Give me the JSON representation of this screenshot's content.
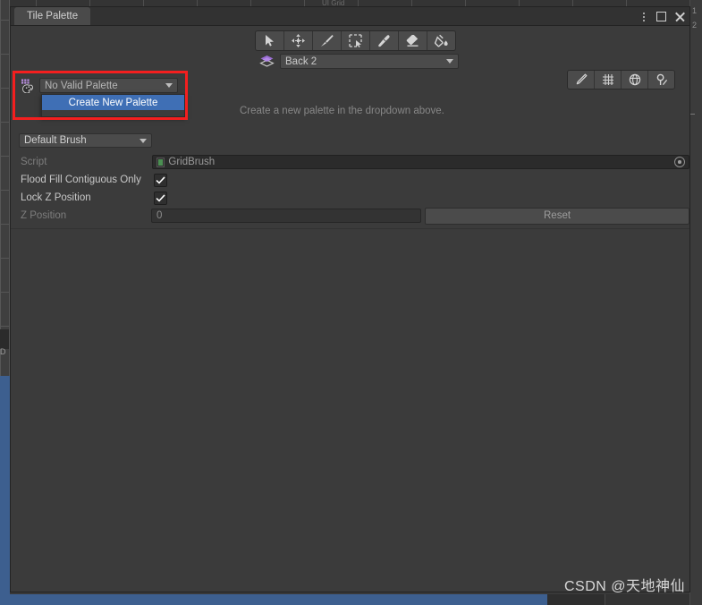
{
  "window": {
    "tab_label": "Tile Palette",
    "controls": {
      "menu": "kebab-menu",
      "maximize": "maximize",
      "close": "close"
    }
  },
  "toolbar": {
    "tools": [
      {
        "name": "select-tool",
        "tooltip": "Select"
      },
      {
        "name": "move-tool",
        "tooltip": "Move"
      },
      {
        "name": "paint-tool",
        "tooltip": "Paint"
      },
      {
        "name": "box-fill-tool",
        "tooltip": "Box Fill"
      },
      {
        "name": "picker-tool",
        "tooltip": "Pick"
      },
      {
        "name": "erase-tool",
        "tooltip": "Erase"
      },
      {
        "name": "fill-tool",
        "tooltip": "Fill"
      }
    ]
  },
  "layer_selector": {
    "icon": "layers-icon",
    "value": "Back 2"
  },
  "right_tools": [
    {
      "name": "edit-pencil-icon",
      "tooltip": "Edit"
    },
    {
      "name": "grid-icon",
      "tooltip": "Grid"
    },
    {
      "name": "gizmo-icon",
      "tooltip": "Gizmos"
    },
    {
      "name": "settings-icon",
      "tooltip": "Settings"
    }
  ],
  "palette_selector": {
    "icon": "tile-palette-icon",
    "value": "No Valid Palette",
    "dropdown_open": true,
    "options": [
      {
        "label": "Create New Palette",
        "selected": true
      }
    ]
  },
  "hint": "Create a new palette in the dropdown above.",
  "brush": {
    "selected": "Default Brush",
    "properties": [
      {
        "label": "Script",
        "type": "object",
        "value": "GridBrush",
        "dimmed": true
      },
      {
        "label": "Flood Fill Contiguous Only",
        "type": "checkbox",
        "value": true,
        "dimmed": false
      },
      {
        "label": "Lock Z Position",
        "type": "checkbox",
        "value": true,
        "dimmed": false
      },
      {
        "label": "Z Position",
        "type": "number",
        "value": "0",
        "dimmed": true
      }
    ],
    "reset_label": "Reset"
  },
  "background": {
    "ruler_numbers": [
      "1",
      "2"
    ],
    "faint_label": "UI Grid",
    "nub_text": "D"
  },
  "watermark": "CSDN @天地神仙",
  "colors": {
    "window_bg": "#3b3b3b",
    "panel_bg": "#393939",
    "tab_active": "#4a4a4a",
    "control_bg": "#4b4b4b",
    "field_bg": "#2b2b2b",
    "text": "#c4c4c4",
    "text_dim": "#7d7d7d",
    "highlight_red": "#f41f1f",
    "menu_selected_blue": "#3f6fb5",
    "accent_purple": "#a06ec9",
    "script_green": "#4b8f52"
  }
}
